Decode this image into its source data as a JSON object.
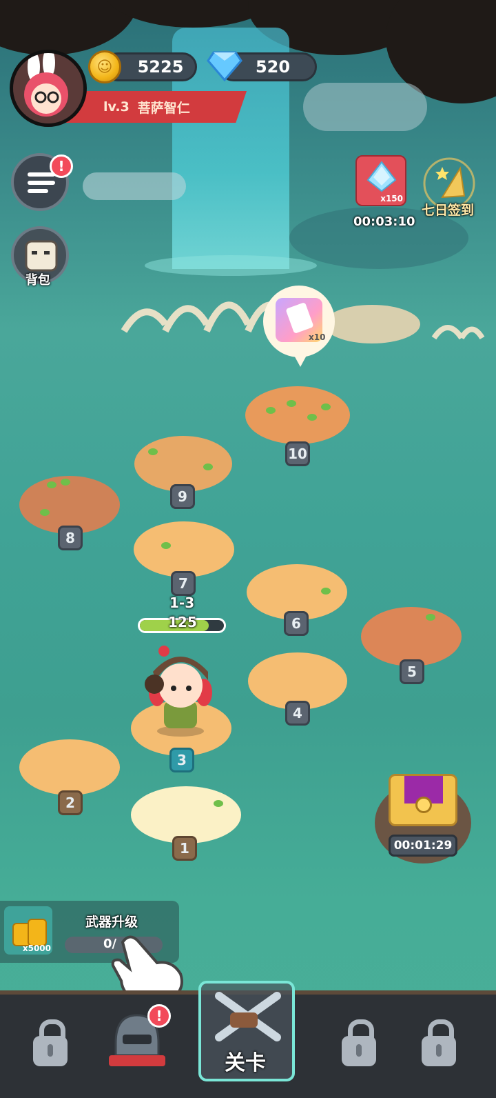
{
  "player": {
    "level": "lv.3",
    "name": "菩萨智仁",
    "coins": "5225",
    "diamonds": "520"
  },
  "left_menu": {
    "menu_badge": "!",
    "backpack_label": "背包"
  },
  "events": {
    "gem_pack_count": "x150",
    "gem_pack_timer": "00:03:10",
    "seven_day_label": "七日签到"
  },
  "reward_bubble": {
    "count": "x10"
  },
  "stages": [
    "1",
    "2",
    "3",
    "4",
    "5",
    "6",
    "7",
    "8",
    "9",
    "10"
  ],
  "current_stage": {
    "label": "1-3",
    "power": "125",
    "progress": 0.82
  },
  "chest": {
    "timer": "00:01:29"
  },
  "weapon_upgrade": {
    "title": "武器升级",
    "coin_count": "x5000",
    "progress_text": "0/"
  },
  "nav": {
    "active_label": "关卡",
    "hero_badge": "!"
  },
  "colors": {
    "accent_red": "#d23b3e",
    "water": "#40a396",
    "nav_bg": "#2d3136"
  }
}
